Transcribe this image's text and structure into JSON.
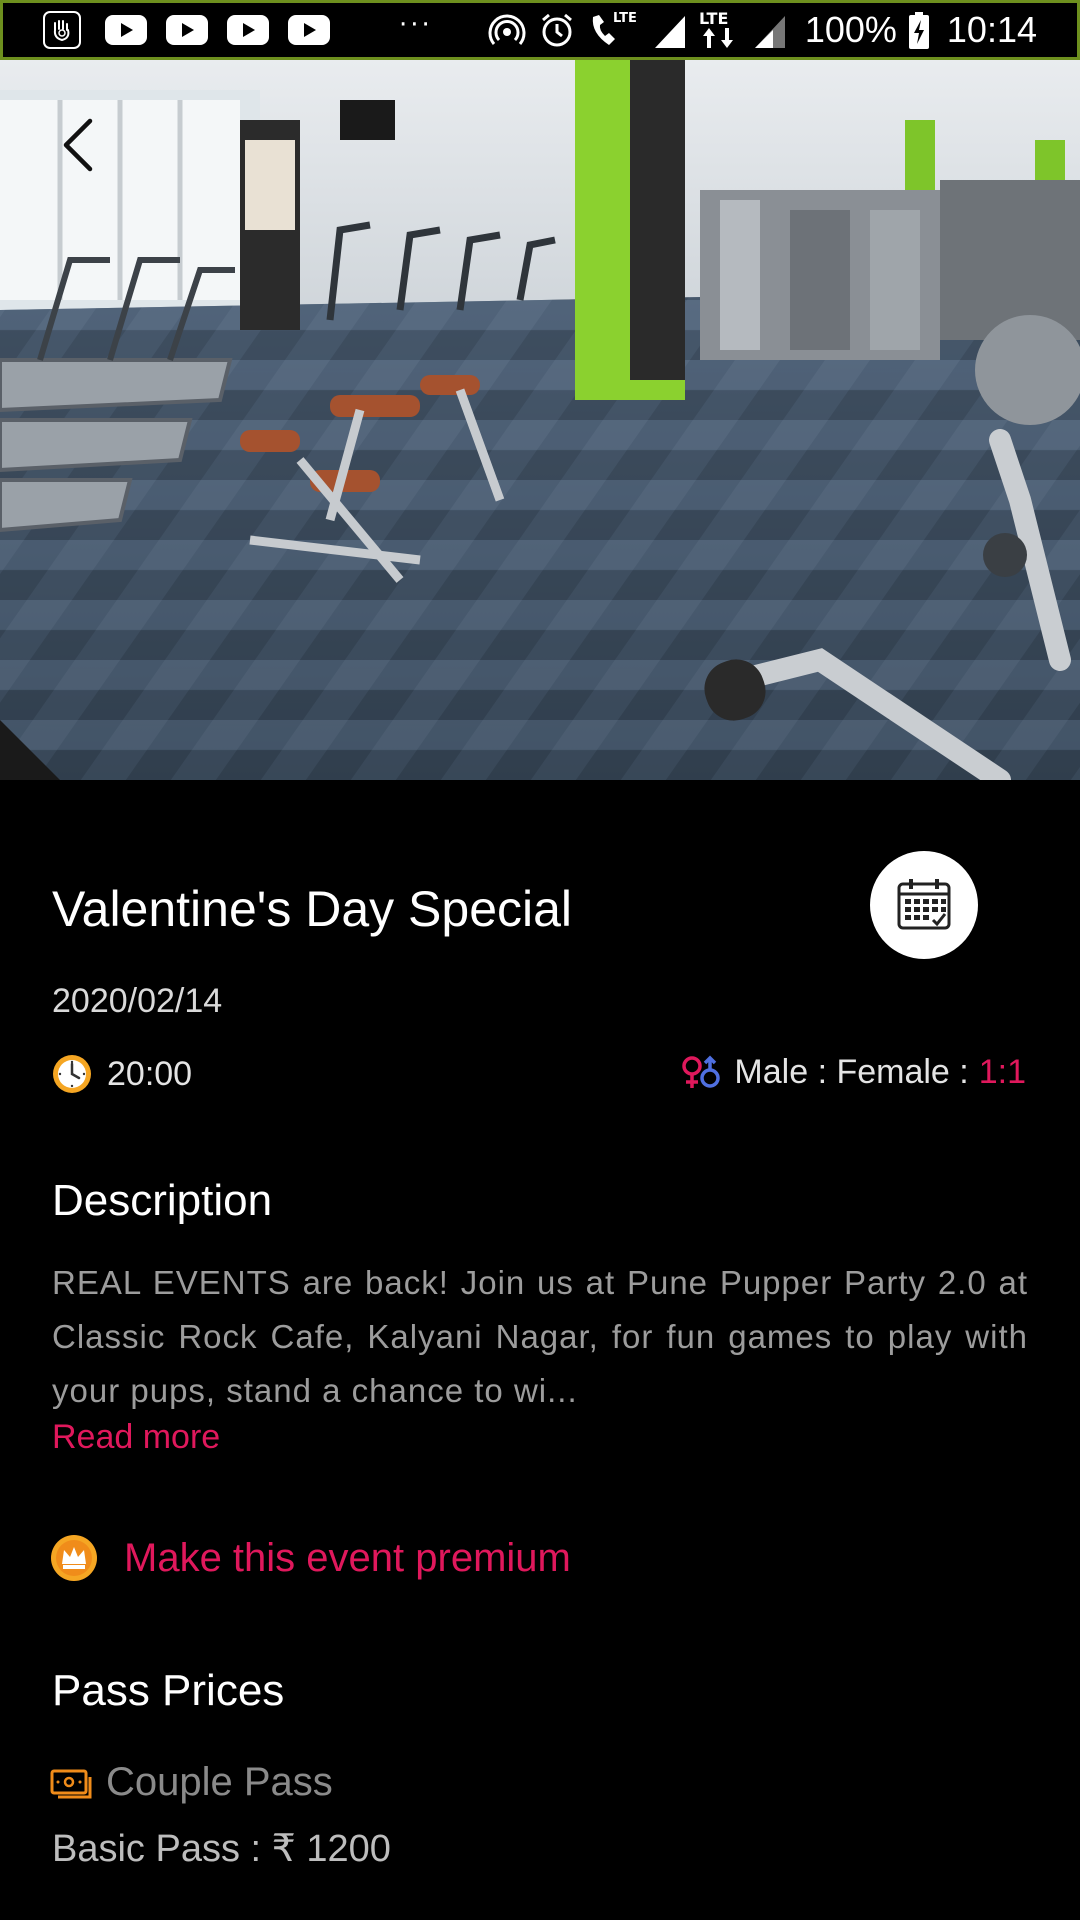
{
  "status_bar": {
    "more": "···",
    "battery": "100%",
    "time": "10:14",
    "icons": [
      "hand-app-icon",
      "youtube-icon",
      "youtube-icon",
      "youtube-icon",
      "youtube-icon",
      "hotspot-icon",
      "alarm-icon",
      "lte-call-icon",
      "signal-icon",
      "lte-data-icon",
      "signal-icon",
      "battery-charging-icon"
    ]
  },
  "hero": {
    "image": "gym-interior-photo",
    "back_icon": "chevron-left-icon"
  },
  "event": {
    "title": "Valentine's Day Special",
    "date": "2020/02/14",
    "time": "20:00",
    "ratio_label": "Male : Female :",
    "ratio_value": "1:1",
    "calendar_icon": "calendar-icon"
  },
  "description": {
    "heading": "Description",
    "text": "REAL EVENTS are back! Join us at Pune Pupper Party 2.0 at Classic Rock Cafe, Kalyani Nagar, for fun games to play with your pups, stand a chance to wi...",
    "read_more": "Read more"
  },
  "premium": {
    "label": "Make this event premium",
    "icon": "crown-icon"
  },
  "pass_prices": {
    "heading": "Pass Prices",
    "pass_name": "Couple Pass",
    "pass_price": "Basic Pass : ₹ 1200",
    "icon": "ticket-icon"
  },
  "colors": {
    "accent": "#e0185c",
    "background": "#000000",
    "clock": "#f5a623"
  }
}
